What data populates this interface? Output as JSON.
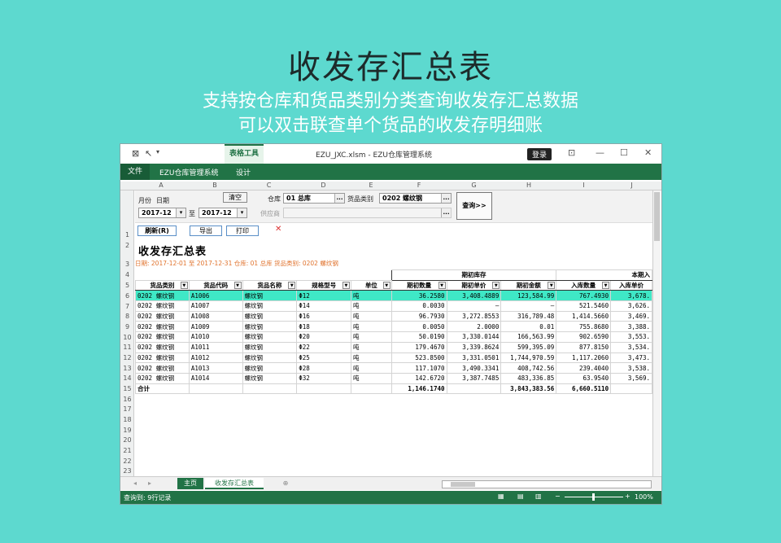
{
  "hero": {
    "title": "收发存汇总表",
    "line1": "支持按仓库和货品类别分类查询收发存汇总数据",
    "line2": "可以双击联查单个货品的收发存明细账"
  },
  "window": {
    "table_tools": "表格工具",
    "doc_title": "EZU_JXC.xlsm - EZU仓库管理系统",
    "login": "登录"
  },
  "ribbon": {
    "file": "文件",
    "tab1": "EZU仓库管理系统",
    "tab2": "设计"
  },
  "columns": [
    "A",
    "B",
    "C",
    "D",
    "E",
    "F",
    "G",
    "H",
    "I",
    "J"
  ],
  "rows": [
    "1",
    "2",
    "3",
    "4",
    "5",
    "6",
    "7",
    "8",
    "9",
    "10",
    "11",
    "12",
    "13",
    "14",
    "15",
    "16",
    "17",
    "18",
    "19",
    "20",
    "21",
    "22",
    "23"
  ],
  "filter": {
    "month_label": "月份",
    "date_label": "日期",
    "clear": "清空",
    "warehouse_label": "仓库",
    "warehouse_value": "01 总库",
    "category_label": "货品类别",
    "category_value": "0202 螺纹钢",
    "date_from": "2017-12",
    "to_label": "至",
    "date_to": "2017-12",
    "supplier_label": "供应商",
    "supplier_value": "",
    "query": "查询>>",
    "dots": "..."
  },
  "toolbar": {
    "refresh": "刷新(R)",
    "export": "导出",
    "print": "打印",
    "close": "✕"
  },
  "report": {
    "title": "收发存汇总表",
    "info": "日期: 2017-12-01 至 2017-12-31    仓库: 01 总库    货品类别: 0202 螺纹钢"
  },
  "table": {
    "group_opening": "期初库存",
    "group_in": "本期入",
    "headers": [
      "货品类别",
      "货品代码",
      "货品名称",
      "规格型号",
      "单位",
      "期初数量",
      "期初单价",
      "期初金额",
      "入库数量",
      "入库单价"
    ],
    "rows": [
      [
        "0202 螺纹钢",
        "A1006",
        "螺纹钢",
        "Φ12",
        "吨",
        "36.2580",
        "3,408.4889",
        "123,584.99",
        "767.4930",
        "3,678."
      ],
      [
        "0202 螺纹钢",
        "A1007",
        "螺纹钢",
        "Φ14",
        "吨",
        "0.0030",
        "–",
        "–",
        "521.5460",
        "3,626."
      ],
      [
        "0202 螺纹钢",
        "A1008",
        "螺纹钢",
        "Φ16",
        "吨",
        "96.7930",
        "3,272.8553",
        "316,789.48",
        "1,414.5660",
        "3,469."
      ],
      [
        "0202 螺纹钢",
        "A1009",
        "螺纹钢",
        "Φ18",
        "吨",
        "0.0050",
        "2.0000",
        "0.01",
        "755.8680",
        "3,388."
      ],
      [
        "0202 螺纹钢",
        "A1010",
        "螺纹钢",
        "Φ20",
        "吨",
        "50.0190",
        "3,330.0144",
        "166,563.99",
        "902.6590",
        "3,553."
      ],
      [
        "0202 螺纹钢",
        "A1011",
        "螺纹钢",
        "Φ22",
        "吨",
        "179.4670",
        "3,339.8624",
        "599,395.09",
        "877.8150",
        "3,534."
      ],
      [
        "0202 螺纹钢",
        "A1012",
        "螺纹钢",
        "Φ25",
        "吨",
        "523.8500",
        "3,331.0501",
        "1,744,970.59",
        "1,117.2060",
        "3,473."
      ],
      [
        "0202 螺纹钢",
        "A1013",
        "螺纹钢",
        "Φ28",
        "吨",
        "117.1070",
        "3,490.3341",
        "408,742.56",
        "239.4040",
        "3,538."
      ],
      [
        "0202 螺纹钢",
        "A1014",
        "螺纹钢",
        "Φ32",
        "吨",
        "142.6720",
        "3,387.7485",
        "483,336.85",
        "63.9540",
        "3,569."
      ]
    ],
    "total": {
      "label": "合计",
      "qty": "1,146.1740",
      "amount": "3,843,383.56",
      "in_qty": "6,660.5110"
    }
  },
  "sheets": {
    "home": "主页",
    "active": "收发存汇总表",
    "add": "⊕"
  },
  "status": {
    "text": "查询到: 9行记录",
    "zoom": "100%"
  },
  "colors": {
    "bg": "#5dd9cf",
    "excel_green": "#217346",
    "selected_row": "#3fe8c6",
    "info_orange": "#e0722c"
  }
}
